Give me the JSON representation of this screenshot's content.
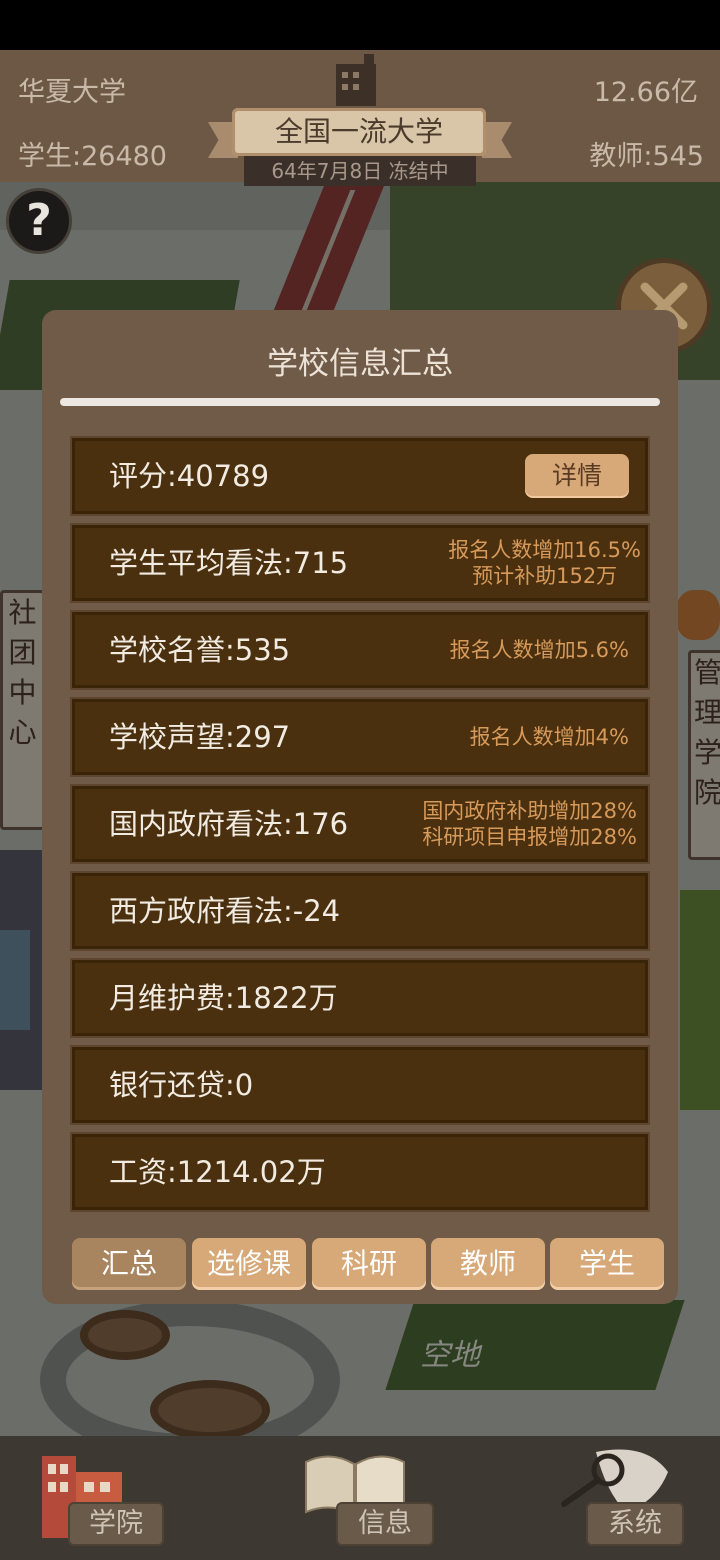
{
  "hud": {
    "school_name": "华夏大学",
    "money": "12.66亿",
    "students": "学生:26480",
    "teachers": "教师:545",
    "rank_title": "全国一流大学",
    "date_status": "64年7月8日 冻结中"
  },
  "map": {
    "left_sign": [
      "社",
      "团",
      "中",
      "心"
    ],
    "right_sign": [
      "管",
      "理",
      "学",
      "院"
    ],
    "empty_lot": "空地"
  },
  "dialog": {
    "title": "学校信息汇总",
    "detail_label": "详情",
    "rows": [
      {
        "label": "评分:40789",
        "notes": []
      },
      {
        "label": "学生平均看法:715",
        "notes": [
          "报名人数增加16.5%",
          "预计补助152万"
        ]
      },
      {
        "label": "学校名誉:535",
        "notes": [
          "报名人数增加5.6%"
        ]
      },
      {
        "label": "学校声望:297",
        "notes": [
          "报名人数增加4%"
        ]
      },
      {
        "label": "国内政府看法:176",
        "notes": [
          "国内政府补助增加28%",
          "科研项目申报增加28%"
        ]
      },
      {
        "label": "西方政府看法:-24",
        "notes": []
      },
      {
        "label": "月维护费:1822万",
        "notes": []
      },
      {
        "label": "银行还贷:0",
        "notes": []
      },
      {
        "label": "工资:1214.02万",
        "notes": []
      }
    ],
    "tabs": [
      "汇总",
      "选修课",
      "科研",
      "教师",
      "学生"
    ],
    "active_tab": "汇总"
  },
  "bottom_nav": [
    "学院",
    "信息",
    "系统"
  ],
  "icons": {
    "help": "help-icon",
    "close": "close-icon",
    "building": "building-icon",
    "college": "college-building-icon",
    "info": "book-icon",
    "system": "magnifier-paper-icon"
  }
}
